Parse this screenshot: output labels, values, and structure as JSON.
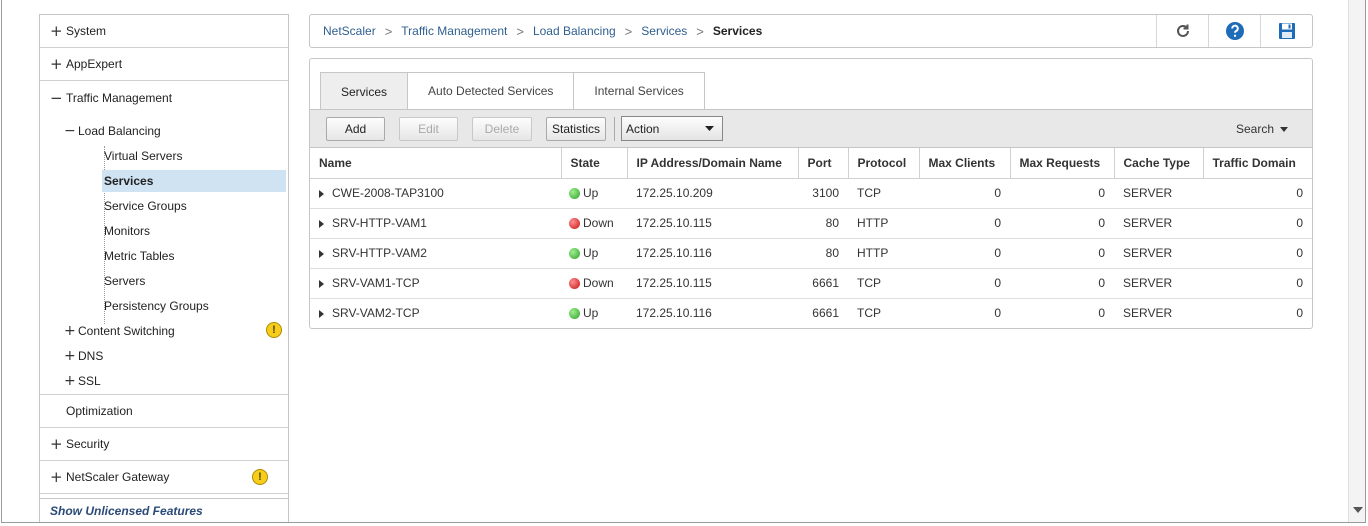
{
  "nav": {
    "sections": {
      "system": "System",
      "appexpert": "AppExpert",
      "traffic_management": "Traffic Management",
      "optimization": "Optimization",
      "security": "Security",
      "gateway": "NetScaler Gateway"
    },
    "load_balancing": "Load Balancing",
    "lb_items": [
      "Virtual Servers",
      "Services",
      "Service Groups",
      "Monitors",
      "Metric Tables",
      "Servers",
      "Persistency Groups"
    ],
    "sub": {
      "content_switching": "Content Switching",
      "dns": "DNS",
      "ssl": "SSL"
    },
    "plus": "+",
    "minus": "−",
    "warn_glyph": "!",
    "unlicensed": "Show Unlicensed Features"
  },
  "breadcrumb": {
    "items": [
      "NetScaler",
      "Traffic Management",
      "Load Balancing",
      "Services"
    ],
    "current": "Services",
    "sep": ">"
  },
  "tabs": [
    "Services",
    "Auto Detected Services",
    "Internal Services"
  ],
  "toolbar": {
    "add": "Add",
    "edit": "Edit",
    "delete": "Delete",
    "statistics": "Statistics",
    "action": "Action",
    "search": "Search"
  },
  "table": {
    "columns": [
      "Name",
      "State",
      "IP Address/Domain Name",
      "Port",
      "Protocol",
      "Max Clients",
      "Max Requests",
      "Cache Type",
      "Traffic Domain"
    ],
    "rows": [
      {
        "name": "CWE-2008-TAP3100",
        "state": "Up",
        "ip": "172.25.10.209",
        "port": "3100",
        "protocol": "TCP",
        "max_clients": "0",
        "max_requests": "0",
        "cache_type": "SERVER",
        "traffic_domain": "0"
      },
      {
        "name": "SRV-HTTP-VAM1",
        "state": "Down",
        "ip": "172.25.10.115",
        "port": "80",
        "protocol": "HTTP",
        "max_clients": "0",
        "max_requests": "0",
        "cache_type": "SERVER",
        "traffic_domain": "0"
      },
      {
        "name": "SRV-HTTP-VAM2",
        "state": "Up",
        "ip": "172.25.10.116",
        "port": "80",
        "protocol": "HTTP",
        "max_clients": "0",
        "max_requests": "0",
        "cache_type": "SERVER",
        "traffic_domain": "0"
      },
      {
        "name": "SRV-VAM1-TCP",
        "state": "Down",
        "ip": "172.25.10.115",
        "port": "6661",
        "protocol": "TCP",
        "max_clients": "0",
        "max_requests": "0",
        "cache_type": "SERVER",
        "traffic_domain": "0"
      },
      {
        "name": "SRV-VAM2-TCP",
        "state": "Up",
        "ip": "172.25.10.116",
        "port": "6661",
        "protocol": "TCP",
        "max_clients": "0",
        "max_requests": "0",
        "cache_type": "SERVER",
        "traffic_domain": "0"
      }
    ]
  },
  "colors": {
    "link": "#2f5f8f",
    "selected": "#cfe3f3",
    "up": "#2ea02a",
    "down": "#c81010",
    "save_icon": "#1e6bb8",
    "help_icon": "#1e6bb8"
  },
  "icons": [
    "refresh-icon",
    "help-icon",
    "save-icon"
  ]
}
